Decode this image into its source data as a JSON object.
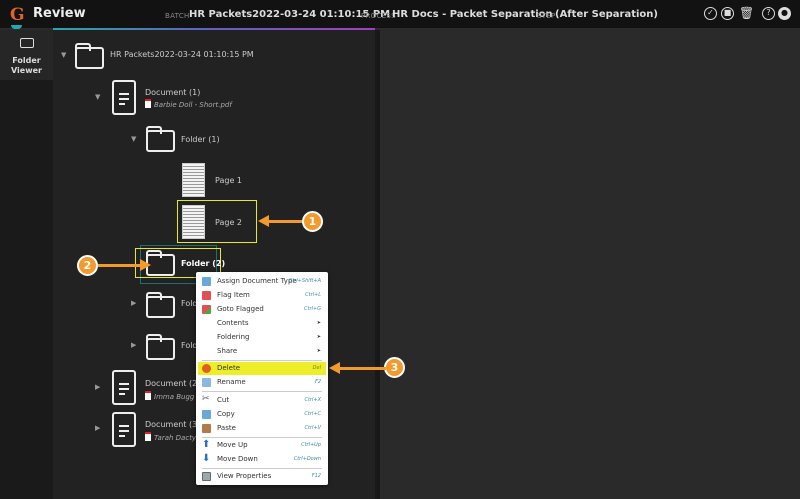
{
  "header": {
    "app_title": "Review",
    "batch_label": "BATCH",
    "batch": "HR Packets2022-03-24 01:10:15 PM",
    "process_label": "PROCESS",
    "process": "HR Docs - Packet Separation",
    "step_label": "STEP",
    "step": "(After Separation)",
    "icons": [
      "check-circle-icon",
      "stop-circle-icon",
      "trash-icon",
      "help-icon",
      "user-icon"
    ]
  },
  "sidebar": {
    "items": [
      {
        "label": "Folder Viewer",
        "icon": "folder-icon"
      }
    ]
  },
  "tree": {
    "root": "HR Packets2022-03-24 01:10:15 PM",
    "doc1": {
      "label": "Document (1)",
      "file": "Barbie Doll - Short.pdf"
    },
    "folder1": "Folder (1)",
    "page1": "Page 1",
    "page2": "Page 2",
    "folder2": "Folder (2)",
    "folder3": "Fold",
    "folder4": "Fold",
    "doc2": {
      "label": "Document (2)",
      "file": "Imma Bugg -"
    },
    "doc3": {
      "label": "Document (3)",
      "file": "Tarah Dactyl"
    }
  },
  "context_menu": [
    {
      "label": "Assign Document Type",
      "shortcut": "Ctrl+Shift+A"
    },
    {
      "label": "Flag Item",
      "shortcut": "Ctrl+L"
    },
    {
      "label": "Goto Flagged",
      "shortcut": "Ctrl+G"
    },
    {
      "label": "Contents",
      "shortcut": "➤"
    },
    {
      "label": "Foldering",
      "shortcut": "➤"
    },
    {
      "label": "Share",
      "shortcut": "➤"
    },
    {
      "label": "Delete",
      "shortcut": "Del"
    },
    {
      "label": "Rename",
      "shortcut": "F2"
    },
    {
      "label": "Cut",
      "shortcut": "Ctrl+X"
    },
    {
      "label": "Copy",
      "shortcut": "Ctrl+C"
    },
    {
      "label": "Paste",
      "shortcut": "Ctrl+V"
    },
    {
      "label": "Move Up",
      "shortcut": "Ctrl+Up"
    },
    {
      "label": "Move Down",
      "shortcut": "Ctrl+Down"
    },
    {
      "label": "View Properties",
      "shortcut": "F12"
    }
  ],
  "callouts": [
    "1",
    "2",
    "3"
  ],
  "colors": {
    "highlight": "#e8e82a",
    "callout": "#f39a2c",
    "accent": "#2aa7a7"
  }
}
